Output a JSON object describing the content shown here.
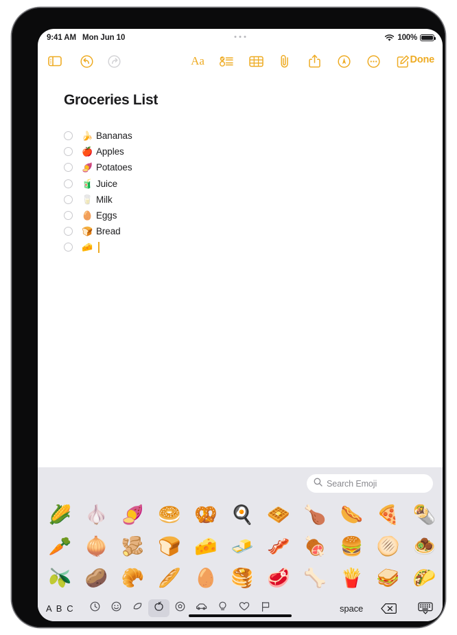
{
  "status_bar": {
    "time": "9:41 AM",
    "date": "Mon Jun 10",
    "wifi_icon": "wifi-icon",
    "battery_percent": "100%",
    "multitask_indicator": "multitasking-dots"
  },
  "toolbar": {
    "sidebar_icon": "sidebar-toggle-icon",
    "undo_icon": "undo-icon",
    "redo_icon": "redo-icon",
    "format_label": "Aa",
    "checklist_icon": "checklist-icon",
    "table_icon": "table-icon",
    "attachment_icon": "paperclip-icon",
    "share_icon": "share-icon",
    "markup_icon": "markup-pen-icon",
    "more_icon": "more-ellipsis-icon",
    "compose_icon": "compose-icon",
    "done_label": "Done",
    "accent_color": "#eeab23"
  },
  "note": {
    "title": "Groceries List",
    "checklist": [
      {
        "emoji": "🍌",
        "label": "Bananas",
        "checked": false
      },
      {
        "emoji": "🍎",
        "label": "Apples",
        "checked": false
      },
      {
        "emoji": "🍠",
        "label": "Potatoes",
        "checked": false
      },
      {
        "emoji": "🧃",
        "label": "Juice",
        "checked": false
      },
      {
        "emoji": "🥛",
        "label": "Milk",
        "checked": false
      },
      {
        "emoji": "🥚",
        "label": "Eggs",
        "checked": false
      },
      {
        "emoji": "🍞",
        "label": "Bread",
        "checked": false
      },
      {
        "emoji": "🧀",
        "label": "",
        "checked": false,
        "has_caret": true
      }
    ]
  },
  "keyboard": {
    "search_placeholder": "Search Emoji",
    "search_icon": "search-icon",
    "emoji_rows": [
      [
        "🌽",
        "🧄",
        "🍠",
        "🥯",
        "🥨",
        "🍳",
        "🧇",
        "🍗",
        "🌭",
        "🍕",
        "🌯"
      ],
      [
        "🥕",
        "🧅",
        "🫚",
        "🍞",
        "🧀",
        "🧈",
        "🥓",
        "🍖",
        "🍔",
        "🫓",
        "🧆"
      ],
      [
        "🫒",
        "🥔",
        "🥐",
        "🥖",
        "🥚",
        "🥞",
        "🥩",
        "🦴",
        "🍟",
        "🥪",
        "🌮"
      ]
    ],
    "abc_label": "A B C",
    "space_label": "space",
    "delete_icon": "delete-backspace-icon",
    "dismiss_icon": "dismiss-keyboard-icon",
    "categories": [
      {
        "name": "category-recents",
        "icon": "clock-recents-icon",
        "active": false
      },
      {
        "name": "category-smileys-people",
        "icon": "smiley-icon",
        "active": false
      },
      {
        "name": "category-animals-nature",
        "icon": "paw-leaf-icon",
        "active": false
      },
      {
        "name": "category-food-drink",
        "icon": "apple-food-icon",
        "active": true
      },
      {
        "name": "category-activity",
        "icon": "ball-activity-icon",
        "active": false
      },
      {
        "name": "category-travel-places",
        "icon": "car-travel-icon",
        "active": false
      },
      {
        "name": "category-objects",
        "icon": "lightbulb-objects-icon",
        "active": false
      },
      {
        "name": "category-symbols",
        "icon": "heart-symbols-icon",
        "active": false
      },
      {
        "name": "category-flags",
        "icon": "flag-icon",
        "active": false
      }
    ]
  }
}
